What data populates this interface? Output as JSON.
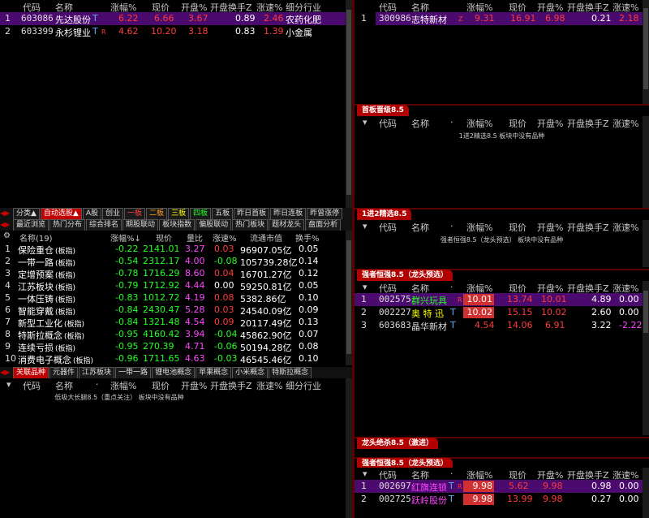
{
  "colors": {
    "accent_red": "#c00000",
    "selected_row": "#4b0a6e",
    "rise": "#ff3b3b",
    "fall": "#22ff22"
  },
  "top_left": {
    "headers": [
      "代码",
      "名称",
      "涨幅%",
      "现价",
      "开盘%",
      "开盘换手Z",
      "涨速%",
      "细分行业"
    ],
    "rows": [
      {
        "idx": "1",
        "code": "603086",
        "name": "先达股份",
        "sup": "T",
        "mark": "",
        "chg": "6.22",
        "price": "6.66",
        "open": "3.67",
        "turn": "0.89",
        "speed": "2.46",
        "ind": "农药化肥"
      },
      {
        "idx": "2",
        "code": "603399",
        "name": "永杉锂业",
        "sup": "T",
        "mark": "R",
        "chg": "4.62",
        "price": "10.20",
        "open": "3.18",
        "turn": "0.83",
        "speed": "1.39",
        "ind": "小金属"
      }
    ]
  },
  "top_right": {
    "headers": [
      "代码",
      "名称",
      "涨幅%",
      "现价",
      "开盘%",
      "开盘换手Z",
      "涨速%"
    ],
    "rows": [
      {
        "idx": "1",
        "code": "300986",
        "name": "志特新材",
        "mark": "Z",
        "chg": "9.31",
        "price": "16.91",
        "open": "6.98",
        "turn": "0.21",
        "speed": "2.18"
      }
    ]
  },
  "sections": {
    "shouban": {
      "tag": "首板晋级8.5",
      "headers": [
        "代码",
        "名称",
        "·",
        "涨幅%",
        "现价",
        "开盘%",
        "开盘换手Z",
        "涨速%"
      ],
      "note": "1进2精选8.5 板块中没有品种"
    },
    "jinji": {
      "tag": "1进2精选8.5",
      "headers": [
        "代码",
        "名称",
        "·",
        "涨幅%",
        "现价",
        "开盘%",
        "开盘换手Z",
        "涨速%"
      ],
      "note": "强者恒强8.5（龙头预选） 板块中没有品种"
    },
    "qiangzhe": {
      "tag": "强者恒强8.5（龙头预选）",
      "headers": [
        "代码",
        "名称",
        "·",
        "涨幅%",
        "现价",
        "开盘%",
        "开盘换手Z",
        "涨速%"
      ],
      "rows": [
        {
          "idx": "1",
          "code": "002575",
          "name": "群兴玩具",
          "mark": "R",
          "chg": "10.01",
          "price": "13.74",
          "open": "10.01",
          "turn": "4.89",
          "speed": "0.00"
        },
        {
          "idx": "2",
          "code": "002227",
          "name": "奥 特 迅",
          "sup": "T",
          "mark": "",
          "chg": "10.02",
          "price": "15.15",
          "open": "10.02",
          "turn": "2.60",
          "speed": "0.00"
        },
        {
          "idx": "3",
          "code": "603683",
          "name": "晶华新材",
          "sup": "T",
          "mark": "",
          "chg": "4.54",
          "price": "14.06",
          "open": "6.91",
          "turn": "3.22",
          "speed": "-2.22"
        }
      ]
    },
    "longtou": {
      "tag": "龙头绝杀8.5（激进）"
    },
    "qiangzhe2": {
      "tag": "强者恒强8.5（龙头预选）",
      "headers": [
        "代码",
        "名称",
        "·",
        "涨幅%",
        "现价",
        "开盘%",
        "开盘换手Z",
        "涨速%"
      ],
      "rows": [
        {
          "idx": "1",
          "code": "002697",
          "name": "红旗连锁",
          "sup": "T",
          "mark": "R",
          "chg": "9.98",
          "price": "5.62",
          "open": "9.98",
          "turn": "0.98",
          "speed": "0.00"
        },
        {
          "idx": "2",
          "code": "002725",
          "name": "跃岭股份",
          "sup": "T",
          "mark": "",
          "chg": "9.98",
          "price": "13.99",
          "open": "9.98",
          "turn": "0.27",
          "speed": "0.00"
        }
      ]
    }
  },
  "tabs1": [
    "分类▲",
    "自动选股▲",
    "A股",
    "创业",
    "一板",
    "二板",
    "三板",
    "四板",
    "五板",
    "昨日首板",
    "昨日连板",
    "昨曾涨停"
  ],
  "tabs2": [
    "最近浏览",
    "热门分布",
    "综合排名",
    "期股联动",
    "板块指数",
    "偏股联动",
    "热门板块",
    "题材龙头",
    "盘面分析"
  ],
  "sector": {
    "headers": [
      "名称(19)",
      "涨幅%↓",
      "现价",
      "量比",
      "涨速%",
      "流通市值",
      "换手%"
    ],
    "rows": [
      {
        "idx": "1",
        "name": "保险重仓",
        "tag": "(板指)",
        "chg": "-0.22",
        "price": "2141.01",
        "vr": "3.27",
        "speed": "0.03",
        "cap": "96907.05亿",
        "turn": "0.05"
      },
      {
        "idx": "2",
        "name": "一带一路",
        "tag": "(板指)",
        "chg": "-0.54",
        "price": "2312.17",
        "vr": "4.00",
        "speed": "-0.08",
        "cap": "105739.28亿",
        "turn": "0.14"
      },
      {
        "idx": "3",
        "name": "定增预案",
        "tag": "(板指)",
        "chg": "-0.78",
        "price": "1716.29",
        "vr": "8.60",
        "speed": "0.04",
        "cap": "16701.27亿",
        "turn": "0.12"
      },
      {
        "idx": "4",
        "name": "江苏板块",
        "tag": "(板指)",
        "chg": "-0.79",
        "price": "1712.92",
        "vr": "4.44",
        "speed": "0.00",
        "cap": "59250.81亿",
        "turn": "0.05"
      },
      {
        "idx": "5",
        "name": "一体压铸",
        "tag": "(板指)",
        "chg": "-0.83",
        "price": "1012.72",
        "vr": "4.19",
        "speed": "0.08",
        "cap": "5382.86亿",
        "turn": "0.10"
      },
      {
        "idx": "6",
        "name": "智能穿戴",
        "tag": "(板指)",
        "chg": "-0.84",
        "price": "2430.47",
        "vr": "5.28",
        "speed": "0.03",
        "cap": "24540.09亿",
        "turn": "0.09"
      },
      {
        "idx": "7",
        "name": "新型工业化",
        "tag": "(板指)",
        "chg": "-0.84",
        "price": "1321.48",
        "vr": "4.54",
        "speed": "0.09",
        "cap": "20117.49亿",
        "turn": "0.13"
      },
      {
        "idx": "8",
        "name": "特斯拉概念",
        "tag": "(板指)",
        "chg": "-0.95",
        "price": "4160.42",
        "vr": "3.94",
        "speed": "-0.04",
        "cap": "45862.90亿",
        "turn": "0.07"
      },
      {
        "idx": "9",
        "name": "连续亏损",
        "tag": "(板指)",
        "chg": "-0.95",
        "price": "270.39",
        "vr": "4.71",
        "speed": "-0.06",
        "cap": "50194.28亿",
        "turn": "0.08"
      },
      {
        "idx": "10",
        "name": "消费电子概念",
        "tag": "(板指)",
        "chg": "-0.96",
        "price": "1711.65",
        "vr": "4.63",
        "speed": "-0.03",
        "cap": "46545.46亿",
        "turn": "0.10"
      }
    ]
  },
  "tabs3": [
    "关联品种",
    "元器件",
    "江苏板块",
    "一带一路",
    "锂电池概念",
    "苹果概念",
    "小米概念",
    "特斯拉概念"
  ],
  "bottom_left": {
    "headers": [
      "代码",
      "名称",
      "·",
      "涨幅%",
      "现价",
      "开盘%",
      "开盘换手Z",
      "涨速%",
      "细分行业"
    ],
    "note": "低吸大长腿8.5（重点关注） 板块中没有品种"
  }
}
